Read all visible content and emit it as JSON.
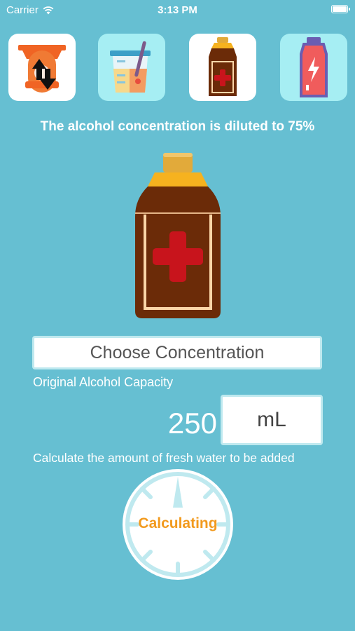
{
  "status": {
    "carrier": "Carrier",
    "time": "3:13 PM"
  },
  "tabs": [
    {
      "name": "scale-tab",
      "icon": "scale-arrows-icon"
    },
    {
      "name": "beaker-tab",
      "icon": "beaker-icon"
    },
    {
      "name": "alcohol-bottle-tab",
      "icon": "medicine-bottle-icon"
    },
    {
      "name": "drink-bottle-tab",
      "icon": "energy-drink-icon"
    }
  ],
  "main": {
    "headline": "The alcohol concentration is diluted to 75%",
    "choose_button": "Choose Concentration",
    "capacity_label": "Original Alcohol Capacity",
    "capacity_value": "250",
    "unit": "mL",
    "water_label": "Calculate the amount of fresh water to be added",
    "calculate_button": "Calculating"
  },
  "colors": {
    "background": "#66bfd2",
    "accent": "#f29a1e",
    "bottle": "#6b2b08",
    "cross": "#c8141c",
    "cap": "#f6b21f"
  }
}
